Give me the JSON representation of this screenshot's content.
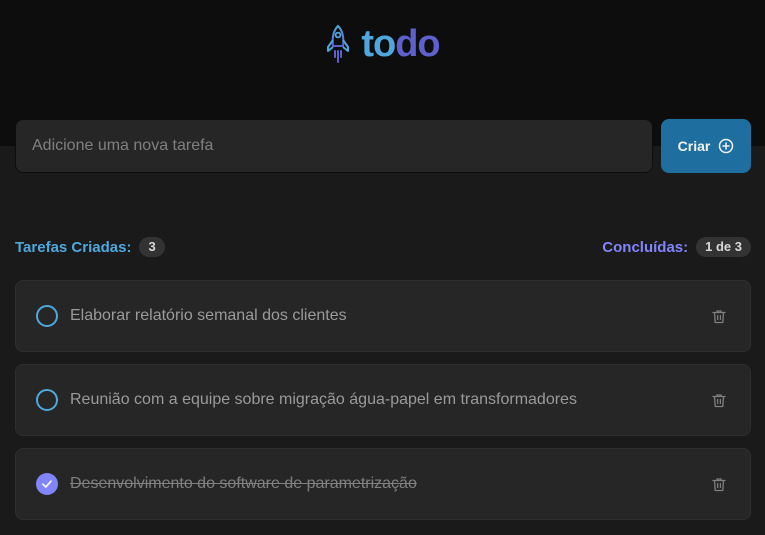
{
  "header": {
    "logo_text_part1": "to",
    "logo_text_part2": "do",
    "logo_icon": "rocket-icon"
  },
  "new_task": {
    "placeholder": "Adicione uma nova tarefa",
    "value": "",
    "create_label": "Criar",
    "create_icon": "plus-circle-icon"
  },
  "counters": {
    "created_label": "Tarefas Criadas:",
    "created_count": "3",
    "done_label": "Concluídas:",
    "done_count": "1 de 3"
  },
  "tasks": [
    {
      "text": "Elaborar relatório semanal dos clientes",
      "completed": false
    },
    {
      "text": "Reunião com a equipe sobre migração água-papel em transformadores",
      "completed": false
    },
    {
      "text": "Desenvolvimento do software de parametrização",
      "completed": true
    }
  ],
  "colors": {
    "blue": "#4ea8de",
    "purple": "#8284fa",
    "dark_purple": "#5e60ce",
    "button_blue": "#1e6f9f",
    "card": "#262626",
    "header_bg": "#0d0d0d",
    "page_bg": "#1a1a1a"
  }
}
